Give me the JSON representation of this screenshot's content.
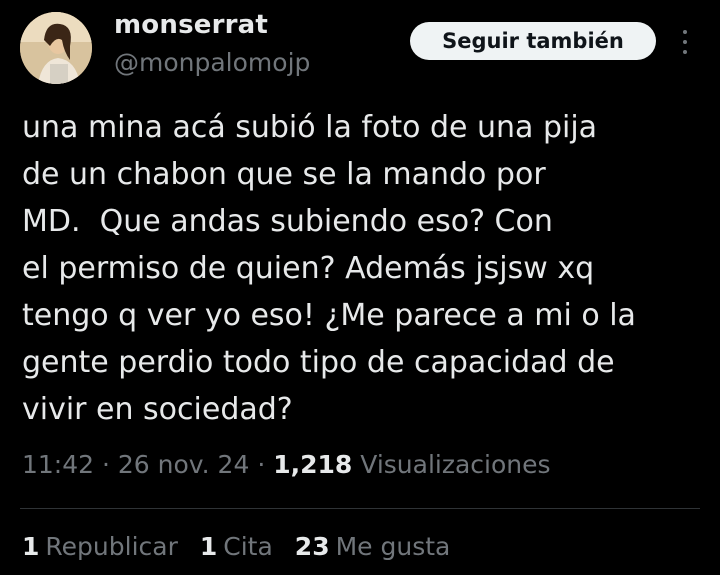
{
  "author": {
    "display_name": "monserrat",
    "handle": "@monpalomojp"
  },
  "follow_button_label": "Seguir también",
  "more_icon": "more-vertical-icon",
  "tweet": {
    "lines": [
      "una mina acá subió la foto de una pija",
      "de un chabon que se la mando por",
      "MD.  Que andas subiendo eso? Con",
      "el permiso de quien? Además jsjsw xq",
      "tengo q ver yo eso! ¿Me parece a mi o la",
      "gente perdio todo tipo de capacidad de",
      "vivir en sociedad?"
    ]
  },
  "meta": {
    "time": "11:42",
    "sep1": "·",
    "date": "26 nov. 24",
    "sep2": "·",
    "views_count": "1,218",
    "views_label": "Visualizaciones"
  },
  "stats": {
    "reposts_count": "1",
    "reposts_label": "Republicar",
    "quotes_count": "1",
    "quotes_label": "Cita",
    "likes_count": "23",
    "likes_label": "Me gusta"
  },
  "colors": {
    "background": "#000000",
    "primary_text": "#e7e9ea",
    "secondary_text": "#71767b",
    "button_bg": "#eff3f4",
    "divider": "#2f3336"
  }
}
